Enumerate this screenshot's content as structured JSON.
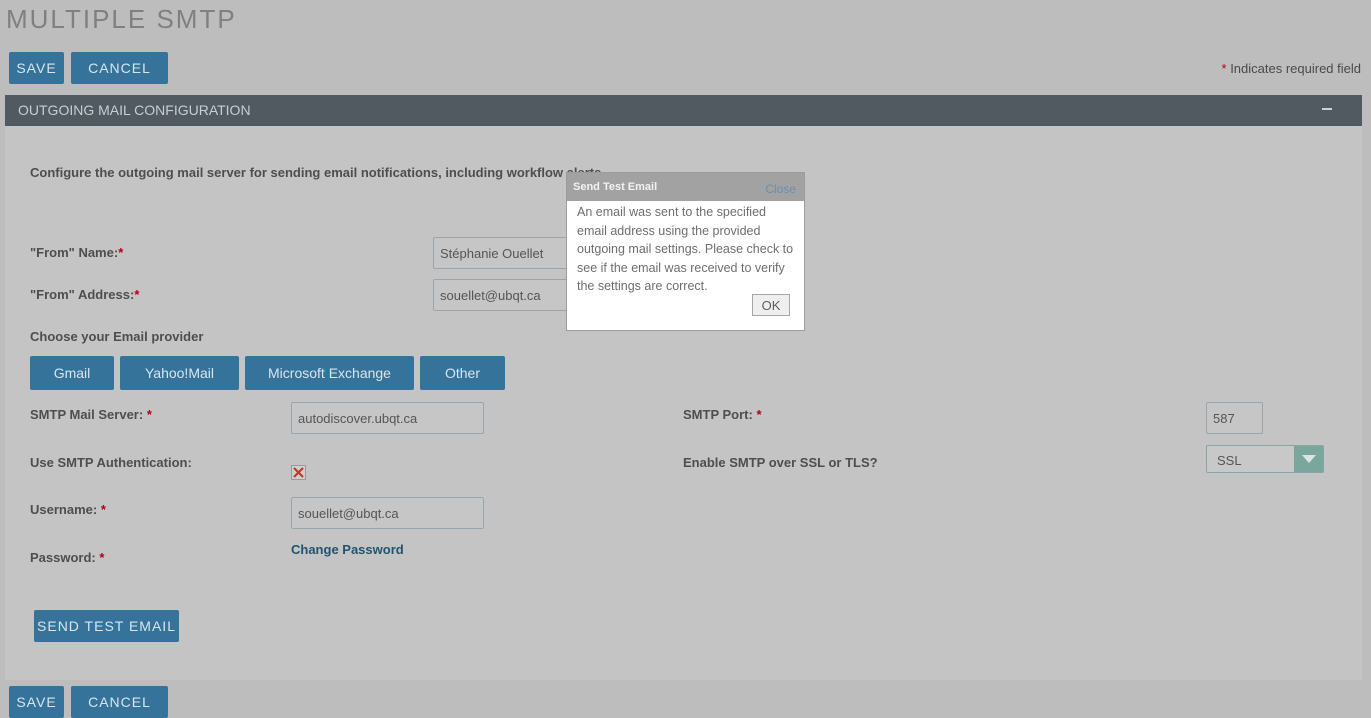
{
  "page": {
    "title": "MULTIPLE SMTP",
    "required_note_star": "*",
    "required_note": "Indicates required field"
  },
  "toolbar": {
    "save_label": "SAVE",
    "cancel_label": "CANCEL"
  },
  "panel": {
    "header": "OUTGOING MAIL CONFIGURATION",
    "description": "Configure the outgoing mail server for sending email notifications, including workflow alerts.",
    "from_name_label": "\"From\" Name:",
    "from_name_value": "Stéphanie Ouellet",
    "from_address_label": "\"From\" Address:",
    "from_address_value": "souellet@ubqt.ca",
    "provider_label": "Choose your Email provider",
    "providers": [
      "Gmail",
      "Yahoo!Mail",
      "Microsoft Exchange",
      "Other"
    ],
    "smtp_server_label": "SMTP Mail Server:",
    "smtp_server_value": "autodiscover.ubqt.ca",
    "smtp_port_label": "SMTP Port:",
    "smtp_port_value": "587",
    "smtp_auth_label": "Use SMTP Authentication:",
    "ssl_label": "Enable SMTP over SSL or TLS?",
    "ssl_value": "SSL",
    "username_label": "Username:",
    "username_value": "souellet@ubqt.ca",
    "password_label": "Password:",
    "change_password": "Change Password",
    "send_test_label": "SEND TEST EMAIL",
    "required_star": "*"
  },
  "dialog": {
    "title": "Send Test Email",
    "close_label": "Close",
    "message": "An email was sent to the specified email address using the provided outgoing mail settings. Please check to see if the email was received to verify the settings are correct.",
    "ok_label": "OK"
  },
  "colors": {
    "primary_button": "#35739a",
    "panel_header": "#515a60",
    "required": "#b0001e"
  }
}
